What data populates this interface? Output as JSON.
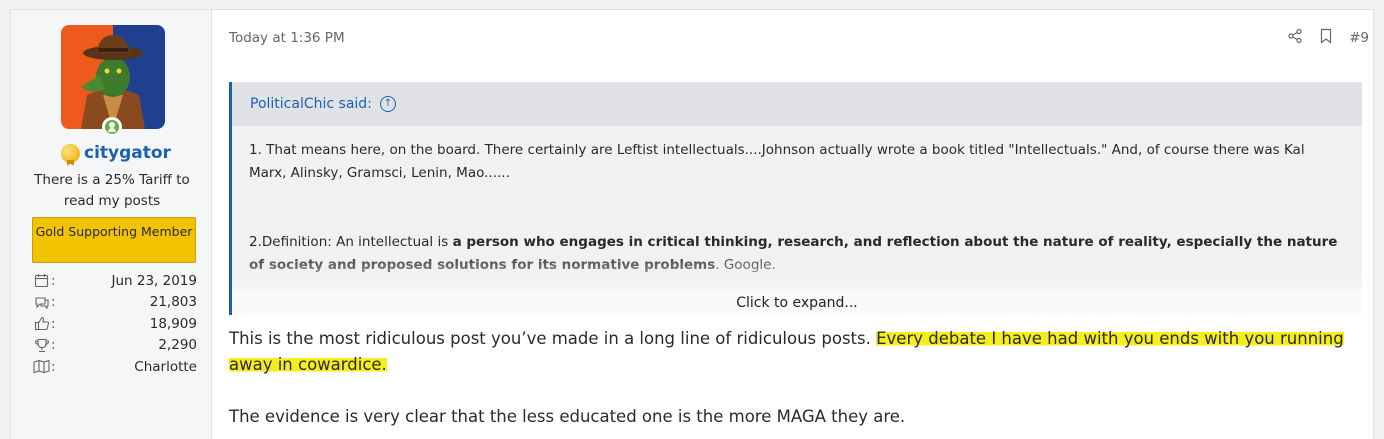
{
  "user": {
    "username": "citygator",
    "title": "There is a 25% Tariff to read my posts",
    "banner": "Gold Supporting Member",
    "stats": [
      {
        "icon": "calendar-icon",
        "value": "Jun 23, 2019"
      },
      {
        "icon": "messages-icon",
        "value": "21,803"
      },
      {
        "icon": "thumbs-up-icon",
        "value": "18,909"
      },
      {
        "icon": "trophy-icon",
        "value": "2,290"
      },
      {
        "icon": "map-icon",
        "value": "Charlotte"
      }
    ],
    "colon": ":"
  },
  "post": {
    "timestamp": "Today at 1:36 PM",
    "number": "#9",
    "quote": {
      "author_said": "PoliticalChic said:",
      "line1": "1. That means here, on the board. There certainly are Leftist intellectuals....Johnson actually wrote a book titled \"Intellectuals.\" And, of course there was Kal Marx, Alinsky, Gramsci, Lenin, Mao......",
      "line2_prefix": "2.Definition: An intellectual is ",
      "line2_bold": "a person who engages in critical thinking, research, and reflection about the nature of reality, especially the nature of society and proposed solutions for its normative problems",
      "line2_suffix": ". Google.",
      "expand_label": "Click to expand..."
    },
    "message": {
      "p1_plain": "This is the most ridiculous post you’ve made in a long line of ridiculous posts. ",
      "p1_highlight": "Every debate I have had with you ends with you running away in cowardice.",
      "p2": "The evidence is very clear that the less educated one is the more MAGA they are."
    }
  },
  "colors": {
    "link": "#1a62b0",
    "banner": "#f2c300",
    "highlight": "#f5ee1a",
    "online": "#63b043"
  }
}
